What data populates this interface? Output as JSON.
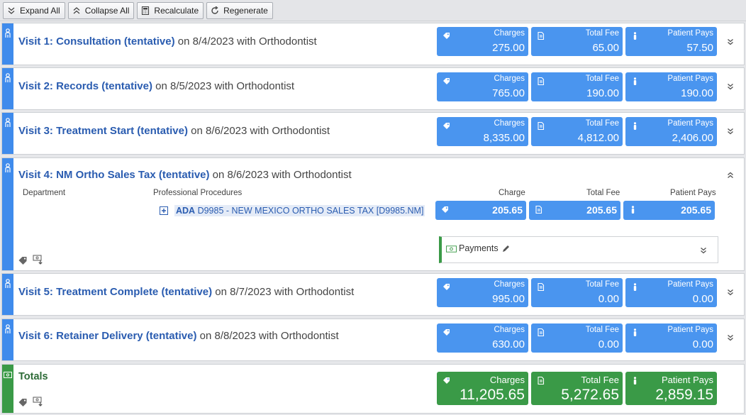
{
  "toolbar": {
    "expand_all": "Expand All",
    "collapse_all": "Collapse All",
    "recalculate": "Recalculate",
    "regenerate": "Regenerate"
  },
  "labels": {
    "charges": "Charges",
    "total_fee": "Total Fee",
    "patient_pays": "Patient Pays",
    "charge": "Charge",
    "department": "Department",
    "professional_procedures": "Professional Procedures",
    "payments": "Payments",
    "totals": "Totals"
  },
  "visits": [
    {
      "name": "Visit 1: Consultation (tentative)",
      "suffix": " on 8/4/2023 with Orthodontist",
      "charges": "275.00",
      "total_fee": "65.00",
      "patient_pays": "57.50"
    },
    {
      "name": "Visit 2: Records (tentative)",
      "suffix": " on 8/5/2023 with Orthodontist",
      "charges": "765.00",
      "total_fee": "190.00",
      "patient_pays": "190.00"
    },
    {
      "name": "Visit 3: Treatment Start (tentative)",
      "suffix": " on 8/6/2023 with Orthodontist",
      "charges": "8,335.00",
      "total_fee": "4,812.00",
      "patient_pays": "2,406.00"
    },
    {
      "name": "Visit 4: NM Ortho Sales Tax (tentative)",
      "suffix": " on 8/6/2023 with Orthodontist",
      "procedure": {
        "prefix": "ADA",
        "code": "D9985",
        "description": " - NEW MEXICO ORTHO SALES TAX [D9985.NM]"
      },
      "charge": "205.65",
      "total_fee": "205.65",
      "patient_pays": "205.65"
    },
    {
      "name": "Visit 5: Treatment Complete (tentative)",
      "suffix": " on 8/7/2023 with Orthodontist",
      "charges": "995.00",
      "total_fee": "0.00",
      "patient_pays": "0.00"
    },
    {
      "name": "Visit 6: Retainer Delivery (tentative)",
      "suffix": " on 8/8/2023 with Orthodontist",
      "charges": "630.00",
      "total_fee": "0.00",
      "patient_pays": "0.00"
    }
  ],
  "totals": {
    "charges": "11,205.65",
    "total_fee": "5,272.65",
    "patient_pays": "2,859.15"
  },
  "colors": {
    "accent_blue": "#4a95ef",
    "sidebar_blue": "#3f8bec",
    "totals_green": "#3a9a47",
    "link": "#2a5cb0"
  }
}
